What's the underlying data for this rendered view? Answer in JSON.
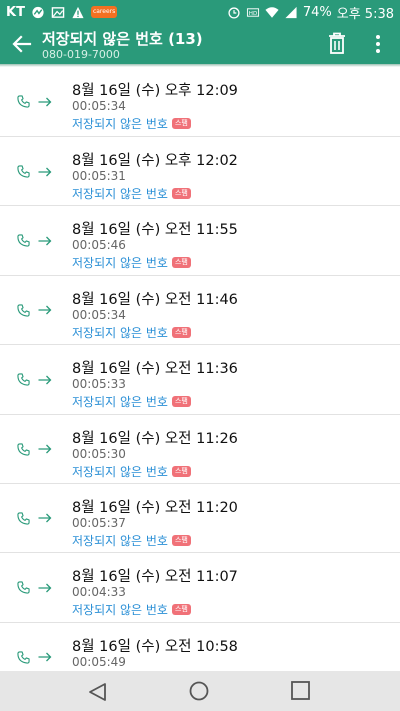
{
  "status_bar": {
    "carrier": "KT",
    "app_badge": "careers",
    "battery": "74%",
    "time": "오후 5:38"
  },
  "header": {
    "title": "저장되지 않은 번호 (13)",
    "number": "080-019-7000"
  },
  "calls": [
    {
      "date": "8월 16일 (수) 오후 12:09",
      "duration": "00:05:34",
      "label": "저장되지 않은 번호",
      "badge": "스팸"
    },
    {
      "date": "8월 16일 (수) 오후 12:02",
      "duration": "00:05:31",
      "label": "저장되지 않은 번호",
      "badge": "스팸"
    },
    {
      "date": "8월 16일 (수) 오전 11:55",
      "duration": "00:05:46",
      "label": "저장되지 않은 번호",
      "badge": "스팸"
    },
    {
      "date": "8월 16일 (수) 오전 11:46",
      "duration": "00:05:34",
      "label": "저장되지 않은 번호",
      "badge": "스팸"
    },
    {
      "date": "8월 16일 (수) 오전 11:36",
      "duration": "00:05:33",
      "label": "저장되지 않은 번호",
      "badge": "스팸"
    },
    {
      "date": "8월 16일 (수) 오전 11:26",
      "duration": "00:05:30",
      "label": "저장되지 않은 번호",
      "badge": "스팸"
    },
    {
      "date": "8월 16일 (수) 오전 11:20",
      "duration": "00:05:37",
      "label": "저장되지 않은 번호",
      "badge": "스팸"
    },
    {
      "date": "8월 16일 (수) 오전 11:07",
      "duration": "00:04:33",
      "label": "저장되지 않은 번호",
      "badge": "스팸"
    },
    {
      "date": "8월 16일 (수) 오전 10:58",
      "duration": "00:05:49",
      "label": "저장되지 않은 번호",
      "badge": "스팸"
    }
  ],
  "colors": {
    "accent": "#2a9a7a",
    "link": "#2a8fd6",
    "spam_badge": "#f07178"
  },
  "icons": {
    "back": "arrow-left-icon",
    "delete": "trash-icon",
    "more": "more-vertical-icon",
    "call_type": "phone-icon",
    "direction": "outgoing-arrow-icon"
  }
}
